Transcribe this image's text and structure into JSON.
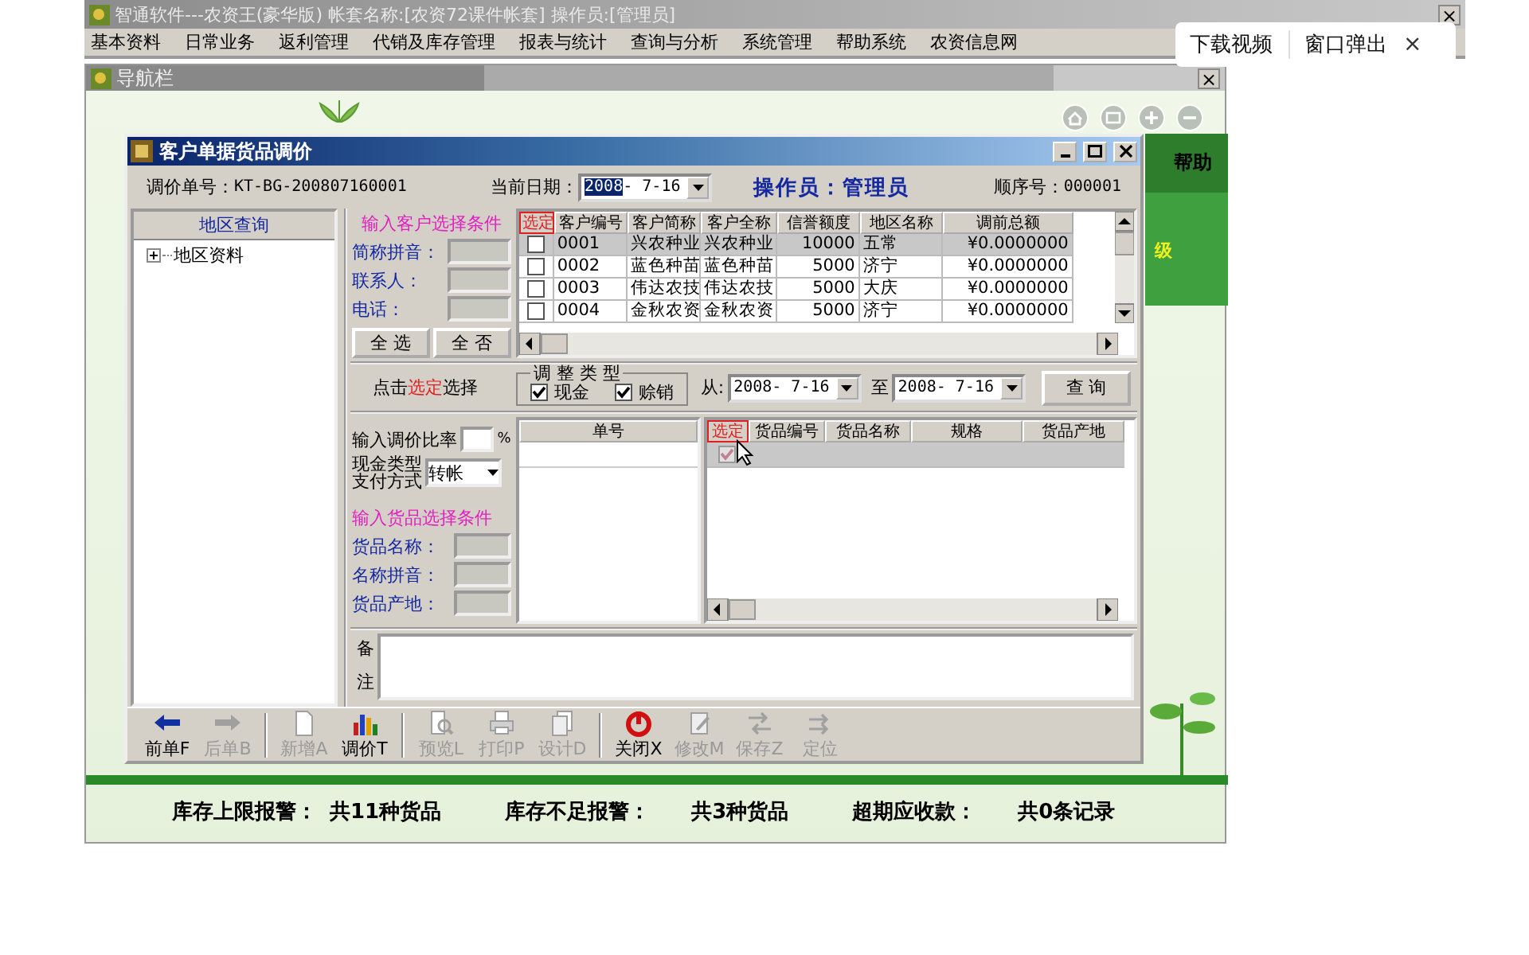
{
  "app": {
    "title": "智通软件---农资王(豪华版) 帐套名称:[农资72课件帐套] 操作员:[管理员]",
    "close": "×"
  },
  "menu": [
    "基本资料",
    "日常业务",
    "返利管理",
    "代销及库存管理",
    "报表与统计",
    "查询与分析",
    "系统管理",
    "帮助系统",
    "农资信息网"
  ],
  "nav_bar": {
    "title": "导航栏",
    "close": "×"
  },
  "side_panel": {
    "help": "帮助",
    "level_text": "级"
  },
  "dialog": {
    "title": "客户单据货品调价",
    "doc_no": {
      "label": "调价单号：",
      "value": "KT-BG-200807160001"
    },
    "current_date": {
      "label": "当前日期：",
      "value": "2008- 7-16"
    },
    "operator": "操作员：管理员",
    "sequence": {
      "label": "顺序号：",
      "value": "000001"
    },
    "region_panel": {
      "title": "地区查询",
      "tree": [
        {
          "label": "地区资料",
          "expanded": false
        }
      ]
    },
    "customer_filter": {
      "title": "输入客户选择条件",
      "fields": [
        "简称拼音：",
        "联系人：",
        "电话："
      ],
      "buttons": [
        "全 选",
        "全 否"
      ]
    },
    "customer_table": {
      "select_header": "选定",
      "columns": [
        "客户编号",
        "客户简称",
        "客户全称",
        "信誉额度",
        "地区名称",
        "调前总额"
      ],
      "rows": [
        {
          "checked": false,
          "selected": true,
          "cells": [
            "0001",
            "兴农种业",
            "兴农种业",
            "10000",
            "五常",
            "¥0.0000000"
          ]
        },
        {
          "checked": false,
          "selected": false,
          "cells": [
            "0002",
            "蓝色种苗",
            "蓝色种苗",
            "5000",
            "济宁",
            "¥0.0000000"
          ]
        },
        {
          "checked": false,
          "selected": false,
          "cells": [
            "0003",
            "伟达农技",
            "伟达农技",
            "5000",
            "大庆",
            "¥0.0000000"
          ]
        },
        {
          "checked": false,
          "selected": false,
          "cells": [
            "0004",
            "金秋农资",
            "金秋农资",
            "5000",
            "济宁",
            "¥0.0000000"
          ]
        }
      ]
    },
    "hint": {
      "before": "点击",
      "highlight": "选定",
      "after": "选择"
    },
    "adjust_type": {
      "title": "调 整 类 型",
      "options": [
        {
          "label": "现金",
          "checked": true
        },
        {
          "label": "赊销",
          "checked": true
        }
      ]
    },
    "date_range": {
      "from_label": "从:",
      "from": "2008- 7-16",
      "to_label": "至",
      "to": "2008- 7-16"
    },
    "query_button": "查 询",
    "rate": {
      "label": "输入调价比率",
      "unit": "%"
    },
    "payment": {
      "label": [
        "现金类型",
        "支付方式"
      ],
      "value": "转帐"
    },
    "goods_filter": {
      "title": "输入货品选择条件",
      "fields": [
        "货品名称：",
        "名称拼音：",
        "货品产地："
      ]
    },
    "doc_list": {
      "columns": [
        "单号"
      ]
    },
    "goods_table": {
      "select_header": "选定",
      "columns": [
        "货品编号",
        "货品名称",
        "规格",
        "货品产地"
      ],
      "rows": [
        {
          "checked": true,
          "selected": true
        }
      ]
    },
    "remarks": {
      "label": "备注"
    },
    "toolbar": [
      {
        "label": "前单F",
        "kind": "prev",
        "disabled": false,
        "separator_after": false
      },
      {
        "label": "后单B",
        "kind": "next",
        "disabled": true,
        "separator_after": true
      },
      {
        "label": "新增A",
        "kind": "new",
        "disabled": true,
        "separator_after": false
      },
      {
        "label": "调价T",
        "kind": "adjust",
        "disabled": false,
        "separator_after": true
      },
      {
        "label": "预览L",
        "kind": "preview",
        "disabled": true,
        "separator_after": false
      },
      {
        "label": "打印P",
        "kind": "print",
        "disabled": true,
        "separator_after": false
      },
      {
        "label": "设计D",
        "kind": "design",
        "disabled": true,
        "separator_after": true
      },
      {
        "label": "关闭X",
        "kind": "close",
        "disabled": false,
        "separator_after": false
      },
      {
        "label": "修改M",
        "kind": "edit",
        "disabled": true,
        "separator_after": false
      },
      {
        "label": "保存Z",
        "kind": "save",
        "disabled": true,
        "separator_after": false
      },
      {
        "label": "定位",
        "kind": "locate",
        "disabled": true,
        "separator_after": false
      }
    ]
  },
  "status_bar": [
    {
      "label": "库存上限报警：",
      "value": "共11种货品"
    },
    {
      "label": "库存不足报警：",
      "value": "共3种货品"
    },
    {
      "label": "超期应收款：",
      "value": "共0条记录"
    }
  ],
  "video_popup": {
    "items": [
      "下载视频",
      "窗口弹出"
    ],
    "close": "×"
  }
}
